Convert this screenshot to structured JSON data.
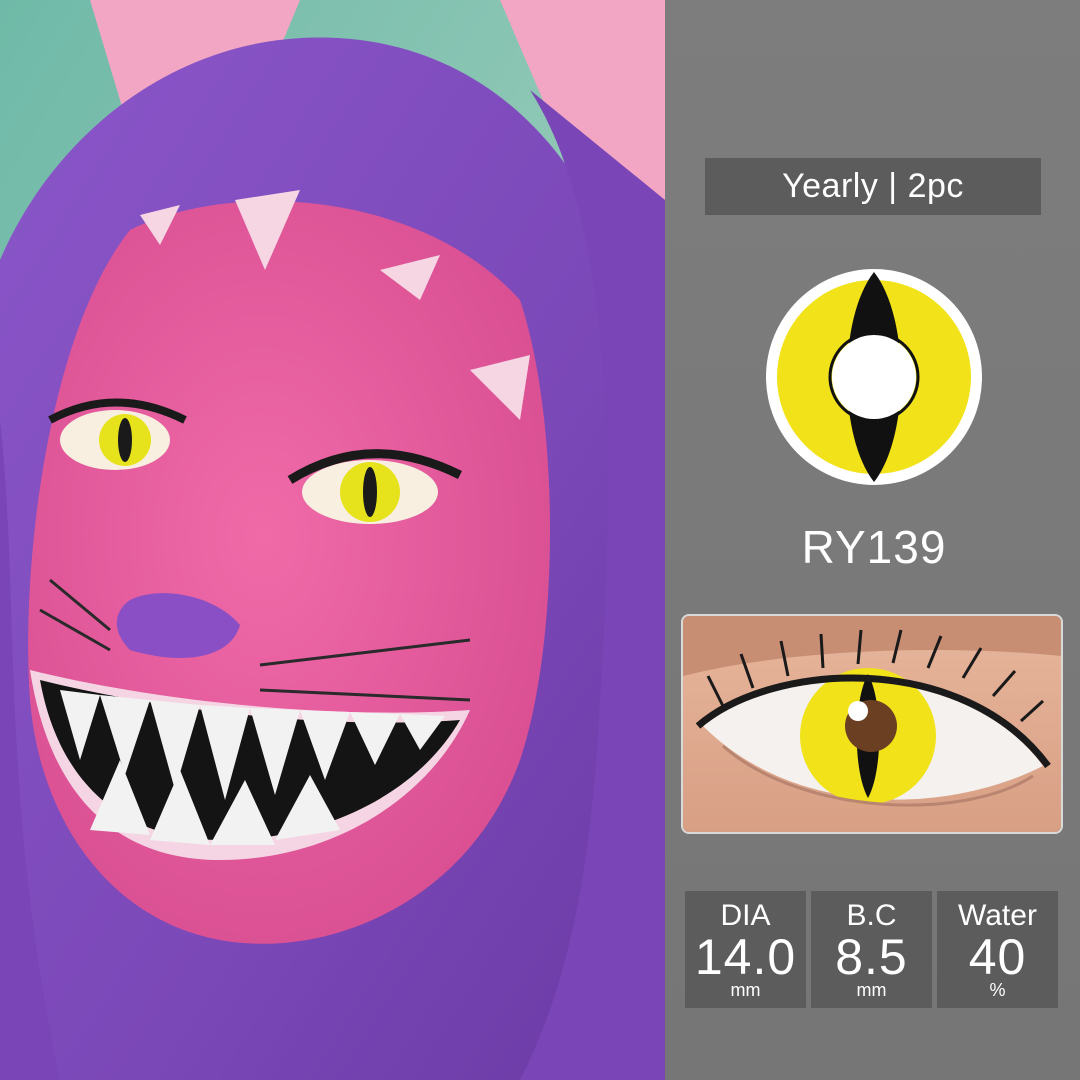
{
  "badge": {
    "text": "Yearly | 2pc"
  },
  "product": {
    "code": "RY139"
  },
  "colors": {
    "lens_yellow": "#f2e21a",
    "panel_gray": "#787878",
    "box_gray": "#5c5c5c"
  },
  "specs": [
    {
      "label": "DIA",
      "value": "14.0",
      "unit": "mm"
    },
    {
      "label": "B.C",
      "value": "8.5",
      "unit": "mm"
    },
    {
      "label": "Water",
      "value": "40",
      "unit": "%"
    }
  ]
}
